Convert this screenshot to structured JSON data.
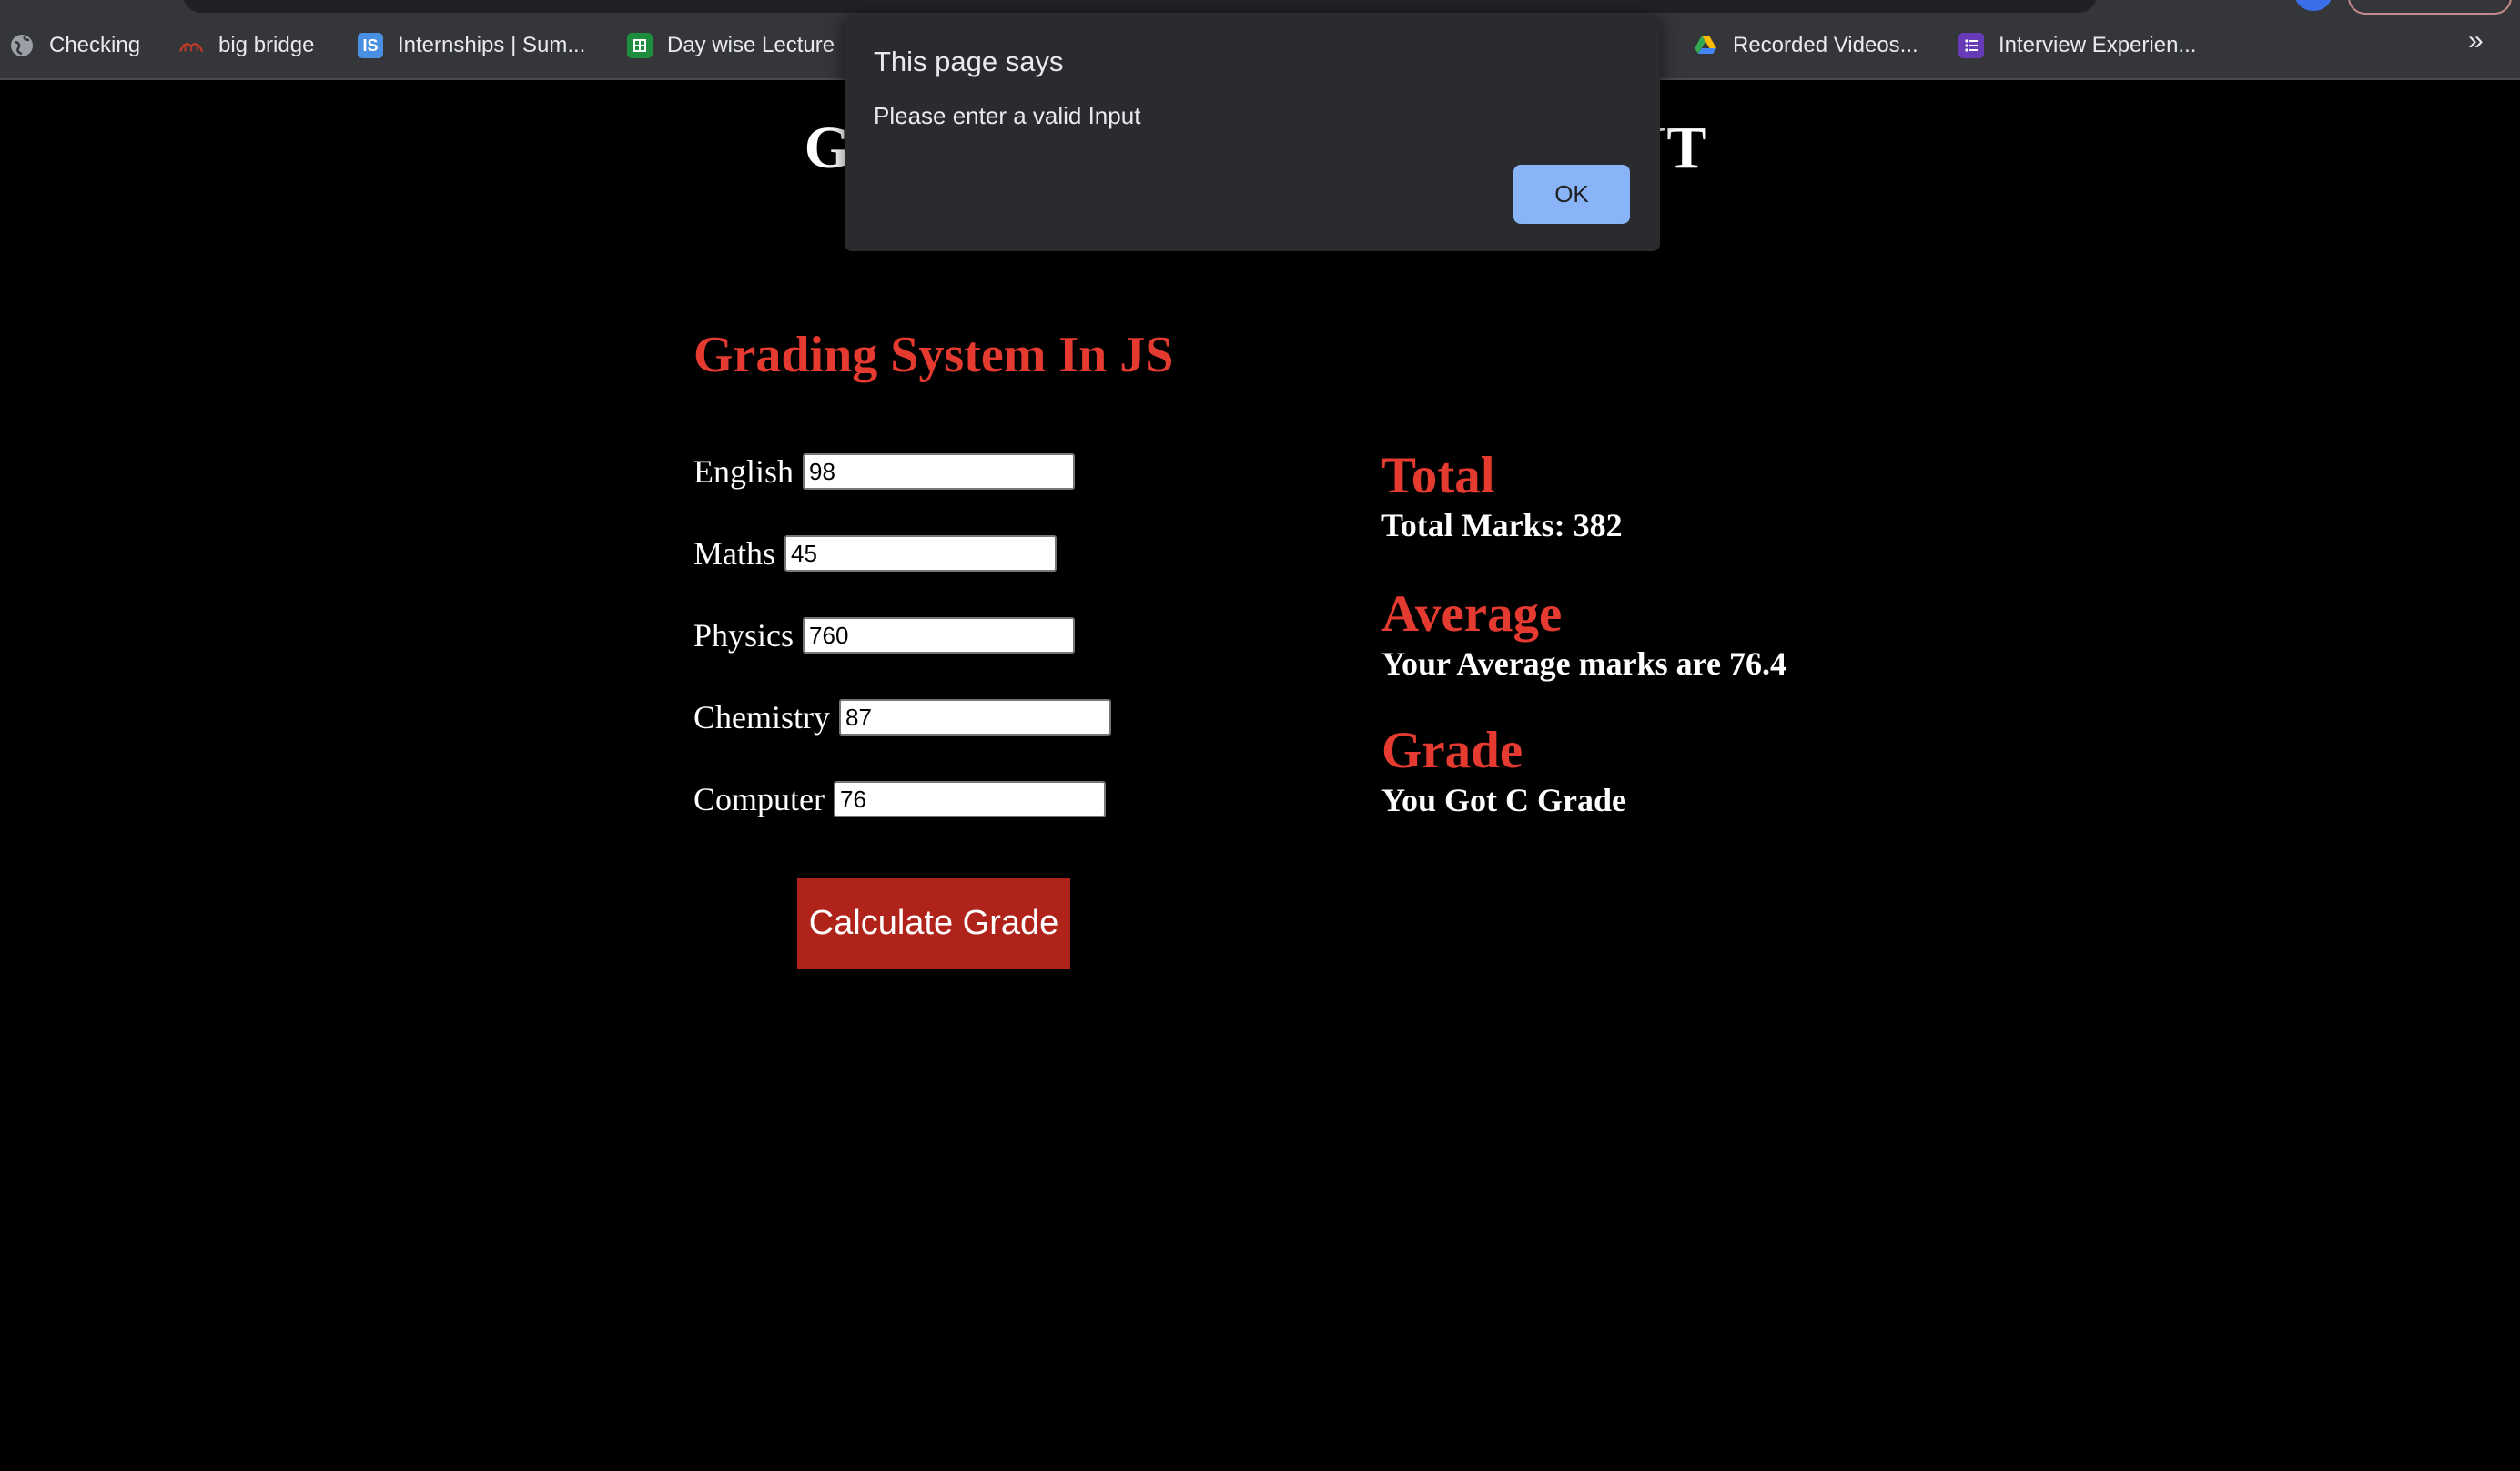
{
  "bookmarks": [
    {
      "label": "Checking",
      "icon": "globe-icon"
    },
    {
      "label": "big bridge",
      "icon": "bridge-icon"
    },
    {
      "label": "Internships | Sum...",
      "icon": "is-logo-icon"
    },
    {
      "label": "Day wise Lecture",
      "icon": "sheets-icon"
    },
    {
      "label": "Recorded Videos...",
      "icon": "drive-icon"
    },
    {
      "label": "Interview Experien...",
      "icon": "forms-icon"
    }
  ],
  "bookmarks_overflow": "»",
  "page": {
    "heading_left": "GI",
    "heading_right": "NT",
    "form_title": "Grading System In JS",
    "subjects": [
      {
        "label": "English",
        "value": "98"
      },
      {
        "label": "Maths",
        "value": "45"
      },
      {
        "label": "Physics",
        "value": "760"
      },
      {
        "label": "Chemistry",
        "value": "87"
      },
      {
        "label": "Computer",
        "value": "76"
      }
    ],
    "calculate_label": "Calculate Grade",
    "results": {
      "total_heading": "Total",
      "total_text": "Total Marks: 382",
      "average_heading": "Average",
      "average_text": "Your Average marks are 76.4",
      "grade_heading": "Grade",
      "grade_text": "You Got C Grade"
    }
  },
  "dialog": {
    "title": "This page says",
    "message": "Please enter a valid Input",
    "ok_label": "OK"
  },
  "colors": {
    "accent_red": "#e43a2f",
    "button_red": "#b0231b",
    "dialog_button": "#8ab4f8",
    "background": "#000000"
  }
}
